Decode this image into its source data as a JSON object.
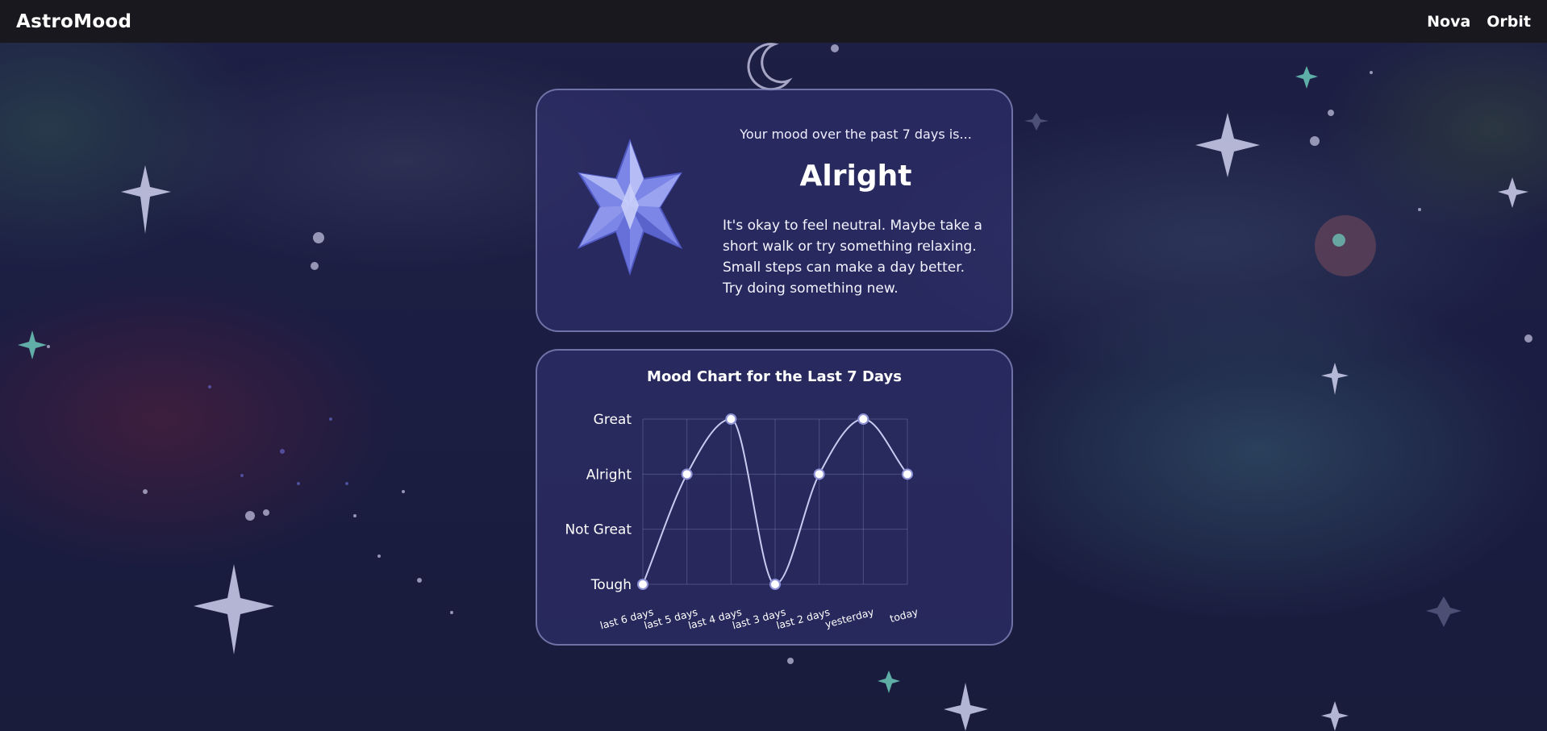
{
  "app": {
    "brand": "AstroMood"
  },
  "nav": {
    "items": [
      "Nova",
      "Orbit"
    ]
  },
  "mood_card": {
    "intro": "Your mood over the past 7 days is...",
    "mood": "Alright",
    "advice": "It's okay to feel neutral. Maybe take a short walk or try something relaxing. Small steps can make a day better. Try doing something new.",
    "icon": "star-icon"
  },
  "chart_card": {
    "title": "Mood Chart for the Last 7 Days"
  },
  "colors": {
    "card_bg": "#303070",
    "card_border": "#aaafe1",
    "line": "#c8cbf0",
    "point_fill": "#ffffff",
    "point_stroke": "#8d91d6",
    "star_light": "#9ea8f0",
    "star_dark": "#5e66cf"
  },
  "chart_data": {
    "type": "line",
    "title": "Mood Chart for the Last 7 Days",
    "categories": [
      "last 6 days",
      "last 5 days",
      "last 4 days",
      "last 3 days",
      "last 2 days",
      "yesterday",
      "today"
    ],
    "y_categories": [
      "Tough",
      "Not Great",
      "Alright",
      "Great"
    ],
    "values": [
      "Tough",
      "Alright",
      "Great",
      "Tough",
      "Alright",
      "Great",
      "Alright"
    ],
    "ylim": [
      0,
      3
    ],
    "grid": true,
    "smooth": true
  }
}
